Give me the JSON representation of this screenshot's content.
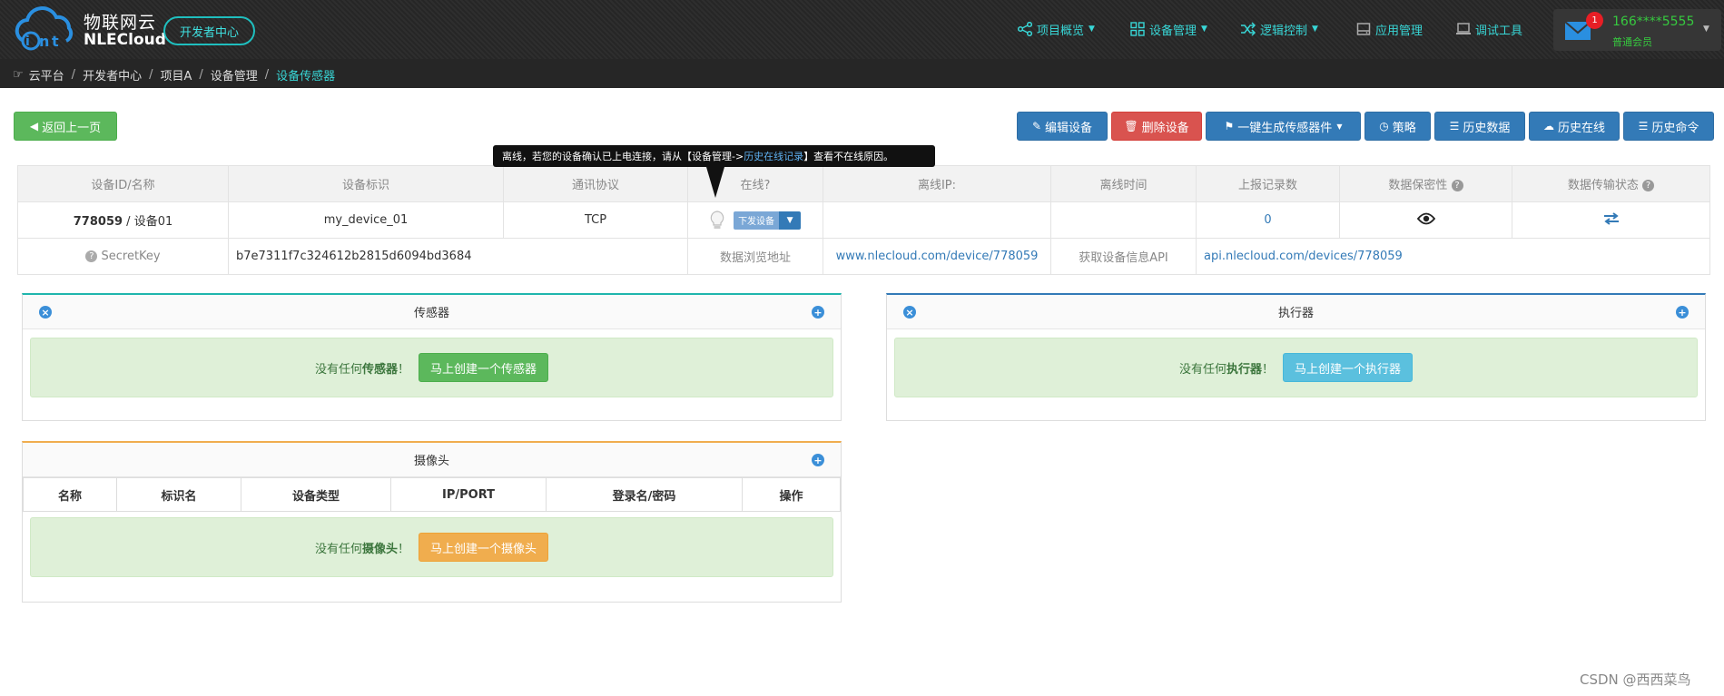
{
  "header": {
    "brand_cn": "物联网云",
    "brand_en": "NLECloud",
    "dev_center": "开发者中心",
    "nav": [
      {
        "label": "项目概览",
        "icon": "share-icon",
        "dropdown": true
      },
      {
        "label": "设备管理",
        "icon": "grid-icon",
        "dropdown": true
      },
      {
        "label": "逻辑控制",
        "icon": "shuffle-icon",
        "dropdown": true
      },
      {
        "label": "应用管理",
        "icon": "hdd-icon",
        "dropdown": false
      },
      {
        "label": "调试工具",
        "icon": "laptop-icon",
        "dropdown": false
      }
    ],
    "user": {
      "badge": "1",
      "name": "166****5555",
      "level": "普通会员"
    }
  },
  "breadcrumb": [
    "云平台",
    "开发者中心",
    "项目A",
    "设备管理",
    "设备传感器"
  ],
  "toolbar": {
    "back": "返回上一页",
    "edit": "编辑设备",
    "delete": "删除设备",
    "generate": "一键生成传感器件",
    "strategy": "策略",
    "history_data": "历史数据",
    "history_online": "历史在线",
    "history_cmd": "历史命令"
  },
  "tooltip": {
    "pre": "离线，若您的设备确认已上电连接，请从【设备管理->",
    "link": "历史在线记录",
    "post": "】查看不在线原因。"
  },
  "device_table": {
    "headers": [
      "设备ID/名称",
      "设备标识",
      "通讯协议",
      "在线?",
      "离线IP:",
      "离线时间",
      "上报记录数",
      "数据保密性",
      "数据传输状态"
    ],
    "row": {
      "id": "778059",
      "name": " / 设备01",
      "tag": "my_device_01",
      "protocol": "TCP",
      "send_btn": "下发设备",
      "offline_ip": "",
      "offline_time": "",
      "report_count": "0"
    },
    "secret_label": "SecretKey",
    "secret_value": "b7e7311f7c324612b2815d6094bd3684",
    "browse_label": "数据浏览地址",
    "browse_url": "www.nlecloud.com/device/778059",
    "api_label": "获取设备信息API",
    "api_url": "api.nlecloud.com/devices/778059"
  },
  "sensor_panel": {
    "title": "传感器",
    "empty_pre": "没有任何",
    "empty_bold": "传感器",
    "empty_post": "！",
    "create": "马上创建一个传感器"
  },
  "actuator_panel": {
    "title": "执行器",
    "empty_pre": "没有任何",
    "empty_bold": "执行器",
    "empty_post": "！",
    "create": "马上创建一个执行器"
  },
  "camera_panel": {
    "title": "摄像头",
    "columns": [
      "名称",
      "标识名",
      "设备类型",
      "IP/PORT",
      "登录名/密码",
      "操作"
    ],
    "empty_pre": "没有任何",
    "empty_bold": "摄像头",
    "empty_post": "！",
    "create": "马上创建一个摄像头"
  },
  "watermark": "CSDN @西西菜鸟",
  "colors": {
    "accent_cyan": "#38d6d6",
    "primary": "#337ab7",
    "success": "#5cb85c",
    "danger": "#d9534f",
    "warning": "#f0ad4e",
    "info": "#5bc0de"
  }
}
